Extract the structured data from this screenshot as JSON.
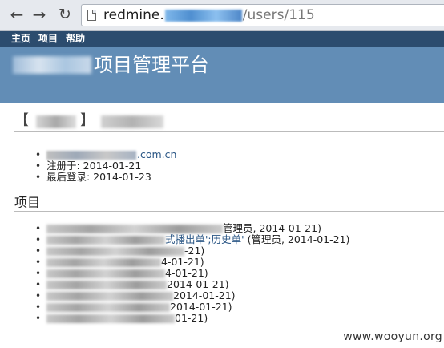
{
  "browser": {
    "url_host": "redmine.",
    "url_path": "/users/115"
  },
  "top_menu": [
    "主页",
    "项目",
    "帮助"
  ],
  "header": {
    "title_suffix": "项目管理平台"
  },
  "user": {
    "bracket_left": "【",
    "bracket_right": "】",
    "email_domain": ".com.cn",
    "registered": "注册于: 2014-01-21",
    "last_login": "最后登录: 2014-01-23"
  },
  "projects_heading": "项目",
  "projects": [
    {
      "visible_text": "管理员, 2014-01-21)",
      "link_text": ""
    },
    {
      "visible_text": " (管理员, 2014-01-21)",
      "link_text": "式播出单';历史单'"
    },
    {
      "visible_text": "-21)",
      "link_text": ""
    },
    {
      "visible_text": "4-01-21)",
      "link_text": ""
    },
    {
      "visible_text": "4-01-21)",
      "link_text": ""
    },
    {
      "visible_text": "2014-01-21)",
      "link_text": ""
    },
    {
      "visible_text": "2014-01-21)",
      "link_text": ""
    },
    {
      "visible_text": "2014-01-21)",
      "link_text": ""
    },
    {
      "visible_text": "01-21)",
      "link_text": ""
    }
  ],
  "watermark": "www.wooyun.org"
}
